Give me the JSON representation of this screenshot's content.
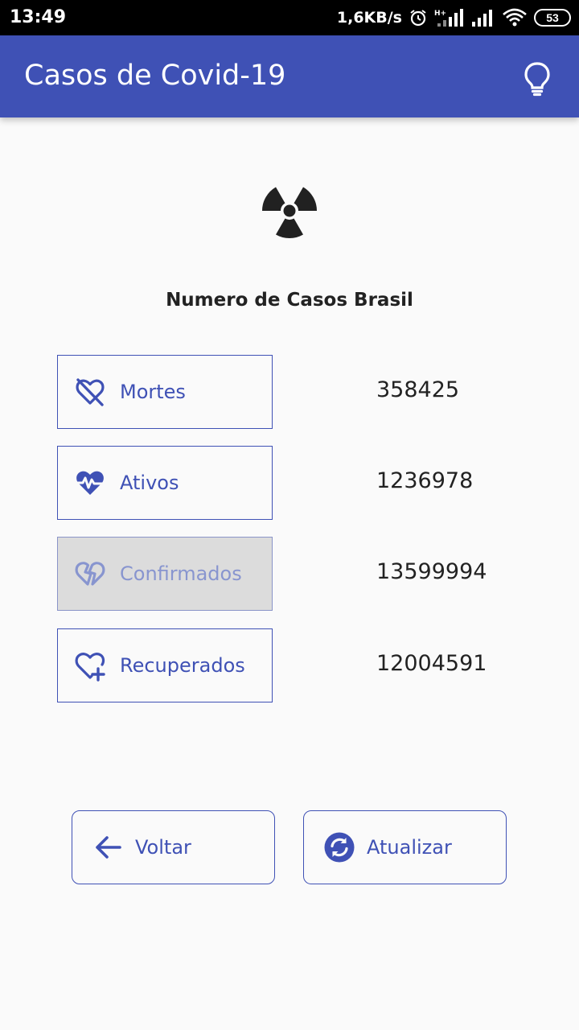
{
  "status_bar": {
    "time": "13:49",
    "net_speed": "1,6KB/s",
    "battery": "53",
    "icons": [
      "alarm-icon",
      "signal-h-plus-icon",
      "signal-icon",
      "wifi-icon",
      "battery-icon"
    ]
  },
  "app_bar": {
    "title": "Casos de Covid-19",
    "action_icon": "lightbulb-icon",
    "color": "#3f51b5"
  },
  "hero_icon": "radiation-icon",
  "subtitle": "Numero de Casos Brasil",
  "stats": [
    {
      "label": "Mortes",
      "value": "358425",
      "icon": "heart-off-icon",
      "selected": false
    },
    {
      "label": "Ativos",
      "value": "1236978",
      "icon": "heart-pulse-icon",
      "selected": false
    },
    {
      "label": "Confirmados",
      "value": "13599994",
      "icon": "heart-broken-icon",
      "selected": true
    },
    {
      "label": "Recuperados",
      "value": "12004591",
      "icon": "heart-plus-icon",
      "selected": false
    }
  ],
  "actions": {
    "back_label": "Voltar",
    "back_icon": "arrow-left-icon",
    "refresh_label": "Atualizar",
    "refresh_icon": "refresh-circle-icon"
  },
  "colors": {
    "accent": "#3f51b5",
    "disabled_bg": "#dcdcdc",
    "background": "#fafafa"
  }
}
